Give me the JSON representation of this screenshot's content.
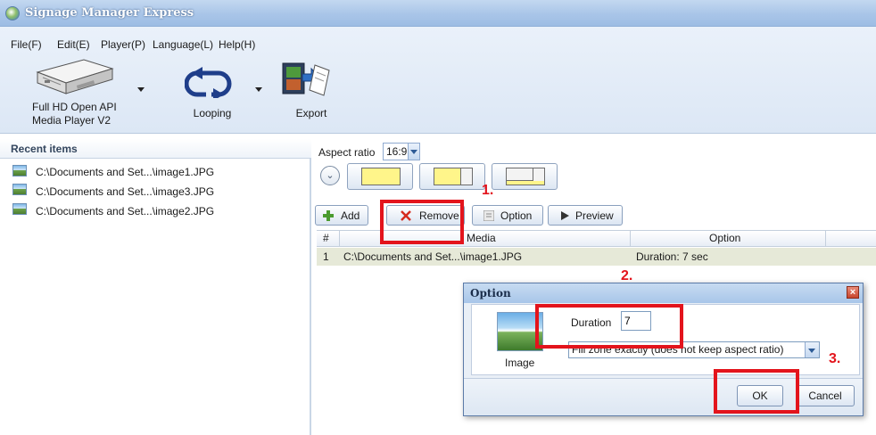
{
  "window": {
    "title": "Signage Manager Express"
  },
  "menu": [
    "File(F)",
    "Edit(E)",
    "Player(P)",
    "Language(L)",
    "Help(H)"
  ],
  "toolbar": {
    "player_label_1": "Full HD Open API",
    "player_label_2": "Media Player V2",
    "looping_label": "Looping",
    "export_label": "Export"
  },
  "recent": {
    "title": "Recent items",
    "items": [
      "C:\\Documents and Set...\\image1.JPG",
      "C:\\Documents and Set...\\image3.JPG",
      "C:\\Documents and Set...\\image2.JPG"
    ]
  },
  "editor": {
    "aspect_label": "Aspect ratio",
    "aspect_value": "16:9",
    "actions": {
      "add": "Add",
      "remove": "Remove",
      "option": "Option",
      "preview": "Preview"
    },
    "columns": [
      "#",
      "Media",
      "Option"
    ],
    "rows": [
      {
        "num": "1",
        "media": "C:\\Documents and Set...\\image1.JPG",
        "option": "Duration: 7 sec"
      }
    ]
  },
  "dialog": {
    "title": "Option",
    "image_label": "Image",
    "duration_label": "Duration",
    "duration_value": "7",
    "fill_mode": "Fill zone exactly (does not keep aspect ratio)",
    "ok": "OK",
    "cancel": "Cancel"
  },
  "annotations": {
    "step1": "1.",
    "step2": "2.",
    "step3": "3."
  },
  "colors": {
    "annotation_red": "#e3141c",
    "row_highlight": "#e6e9d8",
    "titlebar": "#a9c5e8"
  }
}
